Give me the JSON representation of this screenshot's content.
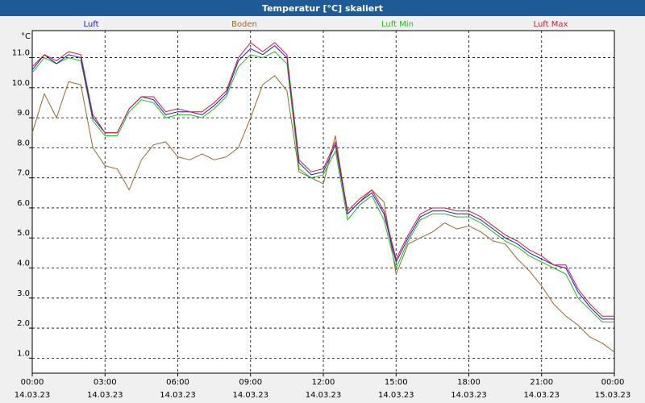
{
  "window": {
    "title": "Temperatur [°C] skaliert"
  },
  "chart_data": {
    "type": "line",
    "title": "Temperatur [°C] skaliert",
    "ylabel": "°C",
    "ylim": [
      0.5,
      11.9
    ],
    "xlim": [
      "14.03.23 00:00",
      "15.03.23 00:00"
    ],
    "grid": true,
    "legend_placement": "top",
    "yticks": [
      "1.0",
      "2.0",
      "3.0",
      "4.0",
      "5.0",
      "6.0",
      "7.0",
      "8.0",
      "9.0",
      "10.0",
      "11.0"
    ],
    "xticks": [
      {
        "time": "00:00",
        "date": "14.03.23"
      },
      {
        "time": "03:00",
        "date": "14.03.23"
      },
      {
        "time": "06:00",
        "date": "14.03.23"
      },
      {
        "time": "09:00",
        "date": "14.03.23"
      },
      {
        "time": "12:00",
        "date": "14.03.23"
      },
      {
        "time": "15:00",
        "date": "14.03.23"
      },
      {
        "time": "18:00",
        "date": "14.03.23"
      },
      {
        "time": "21:00",
        "date": "14.03.23"
      },
      {
        "time": "00:00",
        "date": "15.03.23"
      }
    ],
    "x_hours": [
      0,
      0.5,
      1,
      1.5,
      2,
      2.5,
      3,
      3.5,
      4,
      4.5,
      5,
      5.5,
      6,
      6.5,
      7,
      7.5,
      8,
      8.5,
      9,
      9.5,
      10,
      10.5,
      11,
      11.5,
      12,
      12.5,
      13,
      13.5,
      14,
      14.5,
      15,
      15.5,
      16,
      16.5,
      17,
      17.5,
      18,
      18.5,
      19,
      19.5,
      20,
      20.5,
      21,
      21.5,
      22,
      22.5,
      23,
      23.5,
      24
    ],
    "series": [
      {
        "name": "Luft",
        "color": "#1a1acc",
        "values": [
          10.6,
          11.1,
          10.8,
          11.1,
          11.0,
          9.0,
          8.5,
          8.5,
          9.3,
          9.7,
          9.6,
          9.1,
          9.2,
          9.2,
          9.1,
          9.4,
          9.8,
          10.9,
          11.3,
          11.1,
          11.4,
          11.0,
          7.5,
          7.1,
          7.2,
          8.1,
          5.8,
          6.2,
          6.5,
          5.8,
          4.2,
          5.0,
          5.7,
          5.9,
          5.9,
          5.8,
          5.8,
          5.6,
          5.3,
          5.0,
          4.8,
          4.5,
          4.3,
          4.1,
          4.0,
          3.2,
          2.7,
          2.3,
          2.3
        ]
      },
      {
        "name": "Boden",
        "color": "#996633",
        "values": [
          8.5,
          9.8,
          9.0,
          10.2,
          10.1,
          8.0,
          7.4,
          7.3,
          6.6,
          7.6,
          8.1,
          8.2,
          7.7,
          7.6,
          7.8,
          7.6,
          7.7,
          8.0,
          9.0,
          10.1,
          10.4,
          9.9,
          7.2,
          7.0,
          6.8,
          8.4,
          5.8,
          6.2,
          6.6,
          6.2,
          3.8,
          4.8,
          5.0,
          5.2,
          5.5,
          5.3,
          5.4,
          5.2,
          4.9,
          4.8,
          4.3,
          3.9,
          3.4,
          2.8,
          2.4,
          2.1,
          1.7,
          1.5,
          1.2
        ]
      },
      {
        "name": "Luft Min",
        "color": "#22bb22",
        "values": [
          10.5,
          11.0,
          10.8,
          11.0,
          10.9,
          8.9,
          8.4,
          8.4,
          9.2,
          9.6,
          9.5,
          9.0,
          9.1,
          9.1,
          9.0,
          9.3,
          9.7,
          10.7,
          11.1,
          11.0,
          11.2,
          10.8,
          7.3,
          7.0,
          7.1,
          7.9,
          5.6,
          6.1,
          6.4,
          5.6,
          4.0,
          4.9,
          5.6,
          5.8,
          5.8,
          5.7,
          5.7,
          5.5,
          5.2,
          4.9,
          4.7,
          4.4,
          4.2,
          4.0,
          3.8,
          3.0,
          2.6,
          2.2,
          2.2
        ]
      },
      {
        "name": "Luft Max",
        "color": "#cc1a3a",
        "values": [
          10.7,
          11.1,
          10.9,
          11.2,
          11.1,
          9.1,
          8.5,
          8.5,
          9.3,
          9.7,
          9.7,
          9.2,
          9.3,
          9.2,
          9.2,
          9.5,
          9.9,
          11.0,
          11.5,
          11.2,
          11.5,
          11.1,
          7.6,
          7.2,
          7.3,
          8.2,
          5.9,
          6.3,
          6.6,
          5.9,
          4.3,
          5.1,
          5.8,
          6.0,
          6.0,
          5.9,
          5.9,
          5.7,
          5.4,
          5.1,
          4.9,
          4.6,
          4.4,
          4.1,
          4.1,
          3.3,
          2.8,
          2.4,
          2.4
        ]
      }
    ]
  }
}
